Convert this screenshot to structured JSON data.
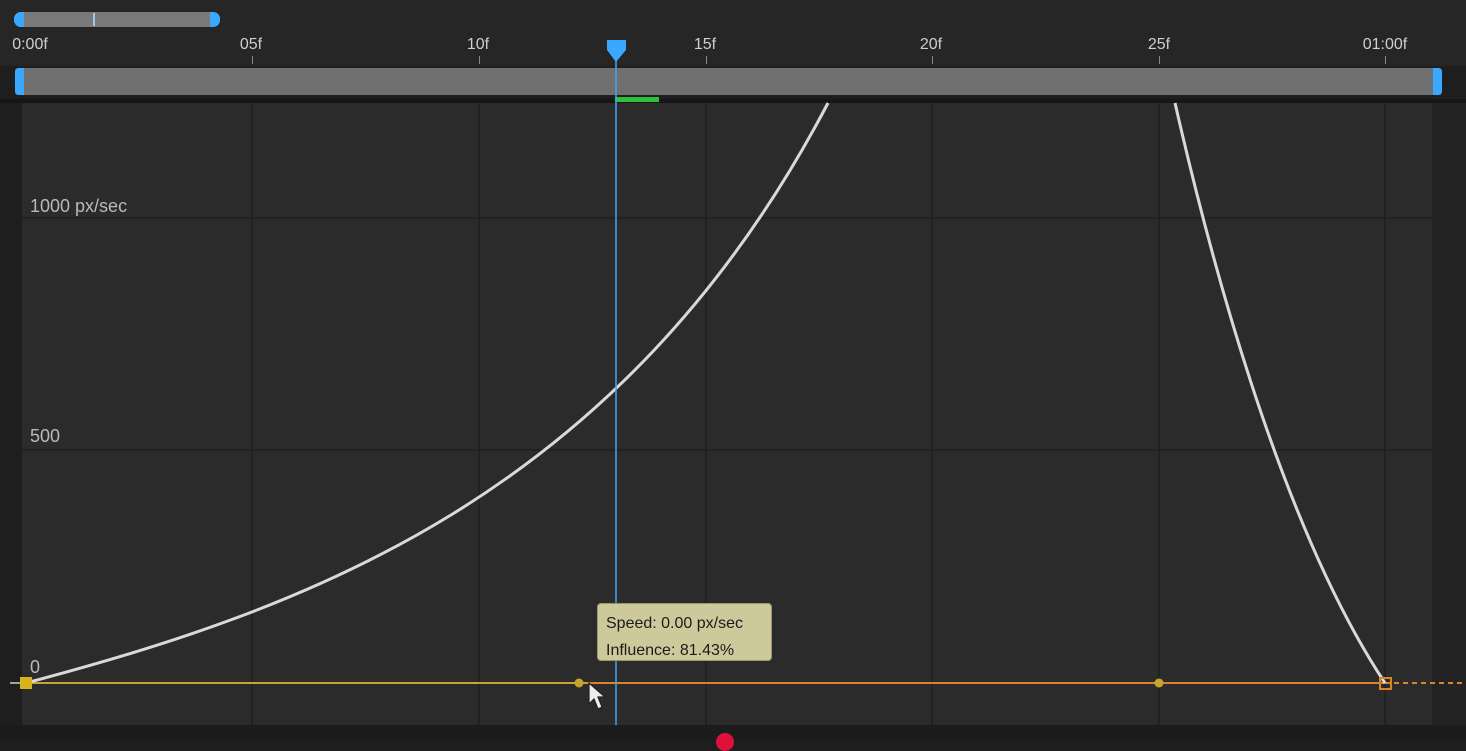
{
  "app": "Graph Editor",
  "timeline": {
    "ticks": [
      "0:00f",
      "05f",
      "10f",
      "15f",
      "20f",
      "25f",
      "01:00f"
    ],
    "current_time_frame": 12.75,
    "in_point_frame": 0,
    "out_point_frame": 30
  },
  "graph": {
    "value_labels": [
      "1000 px/sec",
      "500",
      "0"
    ],
    "curve_color": "#d9d9d9",
    "baseline_color": "#c9a42c",
    "outgoing_color": "#d8852a",
    "playhead_color": "#3aa8ff"
  },
  "tooltip": {
    "speed": "Speed: 0.00 px/sec",
    "influence": "Influence: 81.43%"
  },
  "icons": {
    "playhead": "playhead-marker-icon",
    "cursor": "mouse-pointer-icon",
    "keyframe": "keyframe-square-icon",
    "handle": "bezier-handle-icon"
  }
}
